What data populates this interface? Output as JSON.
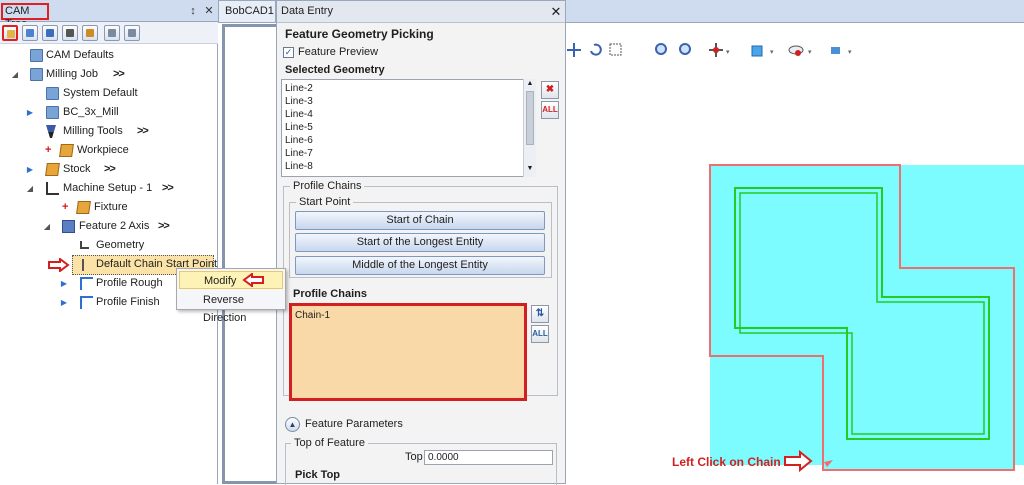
{
  "cam_tree": {
    "title": "CAM Tree",
    "pin": "↕",
    "close": "✕",
    "items": [
      {
        "label": "CAM Defaults"
      },
      {
        "label": "Milling Job",
        "suffix": ">>"
      },
      {
        "label": "System Default"
      },
      {
        "label": "BC_3x_Mill"
      },
      {
        "label": "Milling Tools",
        "suffix": ">>"
      },
      {
        "label": "Workpiece"
      },
      {
        "label": "Stock",
        "suffix": ">>"
      },
      {
        "label": "Machine Setup - 1",
        "suffix": ">>"
      },
      {
        "label": "Fixture"
      },
      {
        "label": "Feature 2 Axis",
        "suffix": ">>"
      },
      {
        "label": "Geometry"
      },
      {
        "label": "Default Chain Start Point"
      },
      {
        "label": "Profile Rough"
      },
      {
        "label": "Profile Finish"
      }
    ]
  },
  "context_menu": {
    "items": [
      "Modify",
      "Reverse Direction"
    ]
  },
  "viewport": {
    "tab": "BobCAD1",
    "annotation": "Left Click on Chain"
  },
  "data_entry": {
    "title": "Data Entry",
    "close": "✕",
    "heading": "Feature Geometry Picking",
    "feature_preview": "Feature Preview",
    "selected_geometry": {
      "label": "Selected Geometry",
      "items": [
        "Line-2",
        "Line-3",
        "Line-4",
        "Line-5",
        "Line-6",
        "Line-7",
        "Line-8"
      ]
    },
    "profile_chains_group": "Profile Chains",
    "start_point_group": "Start Point",
    "buttons": [
      "Start of Chain",
      "Start of the Longest Entity",
      "Middle of the Longest Entity"
    ],
    "profile_chains_label": "Profile Chains",
    "chains": [
      "Chain-1"
    ],
    "feature_parameters": "Feature Parameters",
    "top_of_feature": "Top of Feature",
    "top_label": "Top",
    "top_value": "0.0000",
    "pick_top": "Pick Top"
  }
}
